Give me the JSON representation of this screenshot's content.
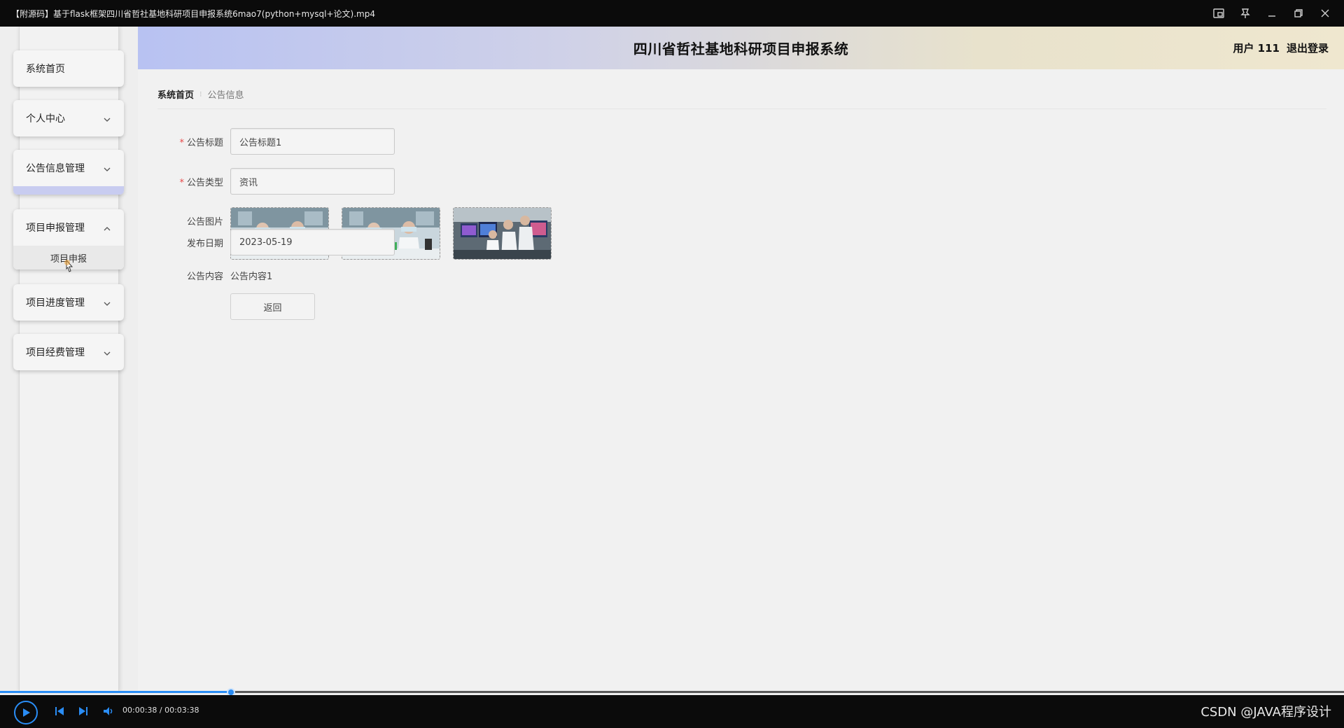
{
  "player": {
    "title": "【附源码】基于flask框架四川省哲社基地科研项目申报系统6mao7(python+mysql+论文).mp4",
    "time": "00:00:38 / 00:03:38",
    "progress_fraction": 0.172,
    "watermark": "CSDN @JAVA程序设计"
  },
  "header": {
    "title": "四川省哲社基地科研项目申报系统",
    "user": "用户 111",
    "logout": "退出登录"
  },
  "sidebar": {
    "items": [
      {
        "label": "系统首页"
      },
      {
        "label": "个人中心"
      },
      {
        "label": "公告信息管理"
      },
      {
        "label": "项目申报管理",
        "submenu": "项目申报"
      },
      {
        "label": "项目进度管理"
      },
      {
        "label": "项目经费管理"
      }
    ]
  },
  "breadcrumb": {
    "home": "系统首页",
    "current": "公告信息"
  },
  "form": {
    "title_label": "公告标题",
    "title_value": "公告标题1",
    "type_label": "公告类型",
    "type_value": "资讯",
    "image_label": "公告图片",
    "date_label": "发布日期",
    "date_value": "2023-05-19",
    "content_label": "公告内容",
    "content_value": "公告内容1",
    "required_mark": "*",
    "back_label": "返回"
  }
}
